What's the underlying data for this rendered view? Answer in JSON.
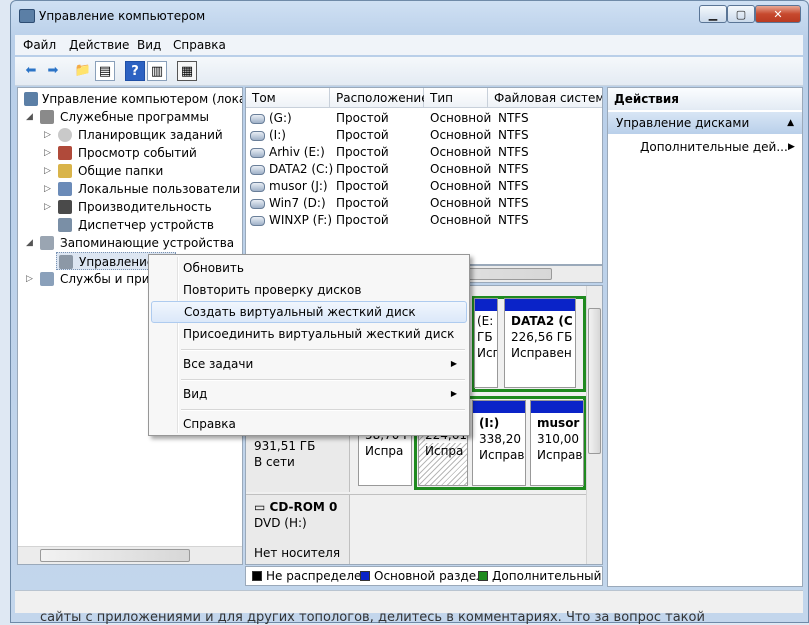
{
  "window": {
    "title": "Управление компьютером"
  },
  "menubar": {
    "items": [
      "Файл",
      "Действие",
      "Вид",
      "Справка"
    ]
  },
  "tree": {
    "items": [
      {
        "label": "Управление компьютером (локальн",
        "level": 0,
        "expander": ""
      },
      {
        "label": "Служебные программы",
        "level": 1,
        "expander": "◢"
      },
      {
        "label": "Планировщик заданий",
        "level": 2,
        "expander": "▷"
      },
      {
        "label": "Просмотр событий",
        "level": 2,
        "expander": "▷"
      },
      {
        "label": "Общие папки",
        "level": 2,
        "expander": "▷"
      },
      {
        "label": "Локальные пользователи и г",
        "level": 2,
        "expander": "▷"
      },
      {
        "label": "Производительность",
        "level": 2,
        "expander": "▷"
      },
      {
        "label": "Диспетчер устройств",
        "level": 2,
        "expander": ""
      },
      {
        "label": "Запоминающие устройства",
        "level": 1,
        "expander": "◢"
      },
      {
        "label": "Управление д",
        "level": 2,
        "expander": ""
      },
      {
        "label": "Службы и прило",
        "level": 1,
        "expander": "▷"
      }
    ]
  },
  "volumes": {
    "columns": [
      "Том",
      "Расположение",
      "Тип",
      "Файловая система"
    ],
    "rows": [
      [
        "(G:)",
        "Простой",
        "Основной",
        "NTFS"
      ],
      [
        "(I:)",
        "Простой",
        "Основной",
        "NTFS"
      ],
      [
        "Arhiv (E:)",
        "Простой",
        "Основной",
        "NTFS"
      ],
      [
        "DATA2 (C:)",
        "Простой",
        "Основной",
        "NTFS"
      ],
      [
        "musor (J:)",
        "Простой",
        "Основной",
        "NTFS"
      ],
      [
        "Win7 (D:)",
        "Простой",
        "Основной",
        "NTFS"
      ],
      [
        "WINXP (F:)",
        "Простой",
        "Основной",
        "NTFS"
      ]
    ]
  },
  "disks": {
    "disk1_parts": [
      {
        "line1": "(E:",
        "line2": "ГБ",
        "line3": "Исправ"
      },
      {
        "line1": "DATA2  (C",
        "line2": "226,56 ГБ",
        "line3": "Исправен"
      }
    ],
    "disk2_info": {
      "line1": "931,51 ГБ",
      "line2": "В сети"
    },
    "disk2_parts": [
      {
        "line1": "",
        "line2": "58,70 I",
        "line3": "Испра"
      },
      {
        "line1": "",
        "line2": "224,61 I",
        "line3": "Испра"
      },
      {
        "line1": "(I:)",
        "line2": "338,20 Г",
        "line3": "Исправ"
      },
      {
        "line1": "musor",
        "line2": "310,00 Г",
        "line3": "Исправ"
      }
    ],
    "cdrom": {
      "name": "CD-ROM 0",
      "drive": "DVD (H:)",
      "status": "Нет носителя"
    }
  },
  "legend": {
    "items": [
      {
        "label": "Не распределен",
        "color": "#000000"
      },
      {
        "label": "Основной раздел",
        "color": "#0a23c8"
      },
      {
        "label": "Дополнительный р",
        "color": "#1f8a1f"
      }
    ]
  },
  "actions": {
    "header": "Действия",
    "section": "Управление дисками",
    "item": "Дополнительные дей..."
  },
  "context_menu": {
    "items": [
      {
        "label": "Обновить",
        "arrow": ""
      },
      {
        "label": "Повторить проверку дисков",
        "arrow": ""
      },
      {
        "label": "Создать виртуальный жесткий диск",
        "arrow": "",
        "highlighted": true
      },
      {
        "label": "Присоединить виртуальный жесткий диск",
        "arrow": ""
      },
      {
        "label": "Все задачи",
        "arrow": "▶"
      },
      {
        "label": "Вид",
        "arrow": "▶"
      },
      {
        "label": "Справка",
        "arrow": ""
      }
    ]
  },
  "background_text": "сайты с приложениями и для других топологов, делитесь в комментариях. Что за вопрос такой"
}
